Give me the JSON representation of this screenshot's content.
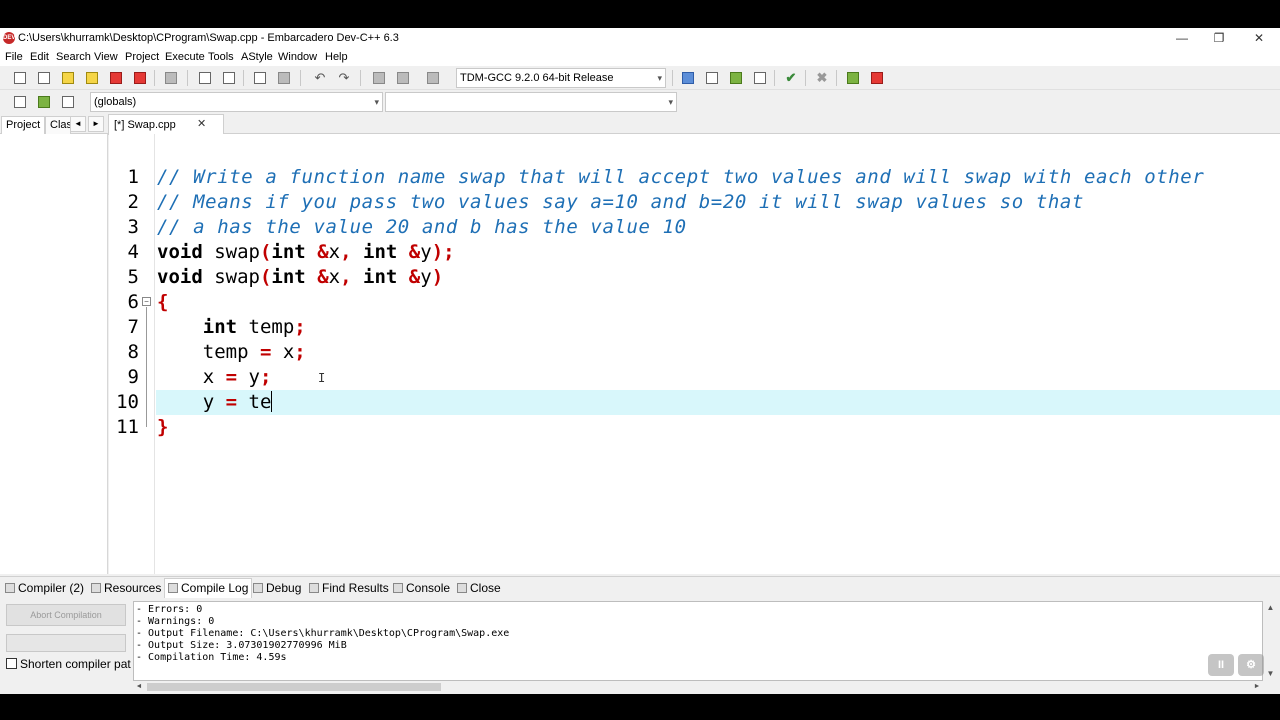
{
  "window": {
    "title": "C:\\Users\\khurramk\\Desktop\\CProgram\\Swap.cpp - Embarcadero Dev-C++ 6.3",
    "app_icon": "DEV",
    "minimize": "—",
    "restore": "❐",
    "close": "✕"
  },
  "menu": [
    "File",
    "Edit",
    "Search",
    "View",
    "Project",
    "Execute",
    "Tools",
    "AStyle",
    "Window",
    "Help"
  ],
  "toolbar": {
    "compiler_select": "TDM-GCC 9.2.0 64-bit Release",
    "scope_select": "(globals)",
    "member_select": ""
  },
  "left_tabs": [
    "Project",
    "Clas"
  ],
  "editor_tab": {
    "label": "[*] Swap.cpp",
    "close": "✕"
  },
  "editor": {
    "line_numbers": [
      "1",
      "2",
      "3",
      "4",
      "5",
      "6",
      "7",
      "8",
      "9",
      "10",
      "11"
    ],
    "fold_marker": "−"
  },
  "bottom_tabs": [
    "Compiler (2)",
    "Resources",
    "Compile Log",
    "Debug",
    "Find Results",
    "Console",
    "Close"
  ],
  "bottom_panel": {
    "abort_button": "Abort Compilation",
    "shorten_label": "Shorten compiler pat",
    "log_lines": [
      "- Errors: 0",
      "- Warnings: 0",
      "- Output Filename: C:\\Users\\khurramk\\Desktop\\CProgram\\Swap.exe",
      "- Output Size: 3.07301902770996 MiB",
      "- Compilation Time: 4.59s"
    ]
  },
  "overlay": {
    "pause": "II",
    "settings": "⚙"
  },
  "colors": {
    "comment": "#1e6fb5",
    "symbol": "#c00000",
    "current_line": "#d8f7fb"
  }
}
